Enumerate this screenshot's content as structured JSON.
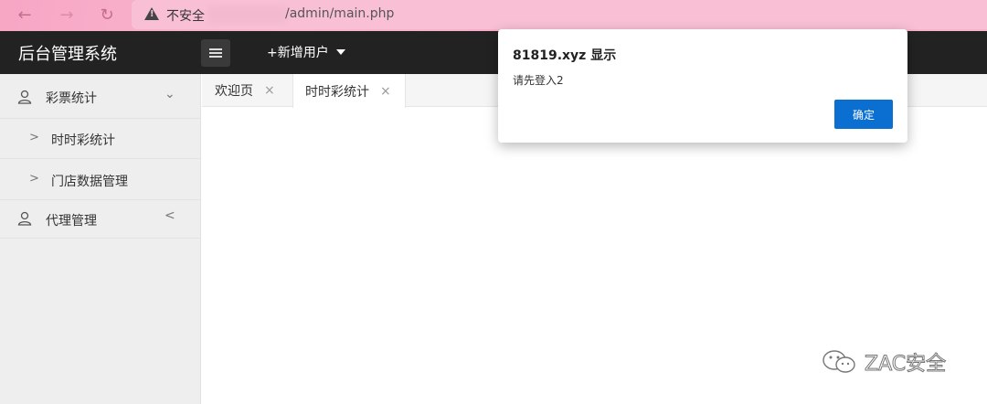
{
  "browser": {
    "url_warning": "不安全",
    "url_path": "/admin/main.php",
    "accent_color": "#f7a6c4"
  },
  "header": {
    "title": "后台管理系统",
    "menu_icon": "hamburger-icon",
    "add_user": "+新增用户"
  },
  "sidebar": {
    "items": [
      {
        "label": "彩票统计",
        "icon": "user-icon",
        "chevron": "chevron-down-icon"
      },
      {
        "label": "时时彩统计",
        "sub": true
      },
      {
        "label": "门店数据管理",
        "sub": true
      },
      {
        "label": "代理管理",
        "icon": "user-icon",
        "chevron": "chevron-left-icon"
      }
    ]
  },
  "tabs": [
    {
      "label": "欢迎页",
      "close": "×"
    },
    {
      "label": "时时彩统计",
      "close": "×",
      "active": true
    }
  ],
  "dialog": {
    "title": "81819.xyz 显示",
    "message": "请先登入2",
    "ok_label": "确定",
    "button_color": "#0b6fd1"
  },
  "watermark": {
    "text": "ZAC安全",
    "icon": "wechat-icon"
  }
}
